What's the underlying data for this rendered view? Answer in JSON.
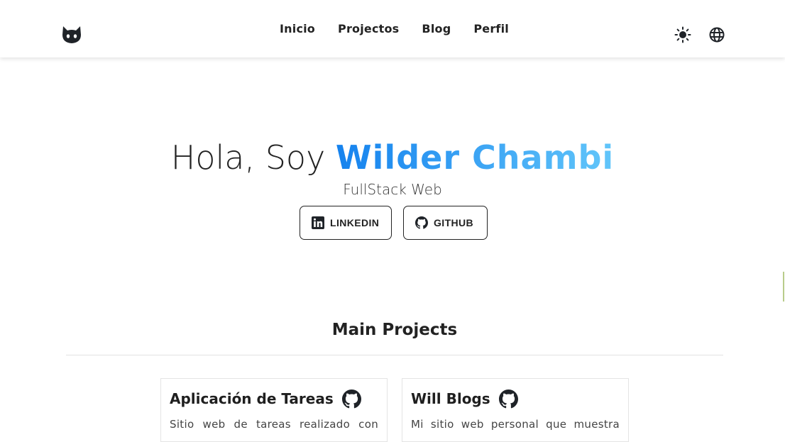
{
  "nav": {
    "logo_icon": "github-octocat-icon",
    "links": [
      {
        "label": "Inicio"
      },
      {
        "label": "Projectos"
      },
      {
        "label": "Blog"
      },
      {
        "label": "Perfil"
      }
    ],
    "theme_icon": "sun-icon",
    "language_icon": "globe-icon"
  },
  "hero": {
    "greeting": "Hola, Soy ",
    "name": "Wilder Chambi",
    "subtitle": "FullStack Web",
    "buttons": {
      "linkedin": "LINKEDIN",
      "github": "GITHUB"
    },
    "name_gradient": [
      "#1582ee",
      "#62c6fa"
    ]
  },
  "projects": {
    "section_title": "Main Projects",
    "items": [
      {
        "title": "Aplicación de Tareas",
        "description": "Sitio web de tareas realizado con",
        "icon": "github-icon"
      },
      {
        "title": "Will Blogs",
        "description": "Mi sitio web personal que muestra",
        "icon": "github-icon"
      }
    ]
  }
}
